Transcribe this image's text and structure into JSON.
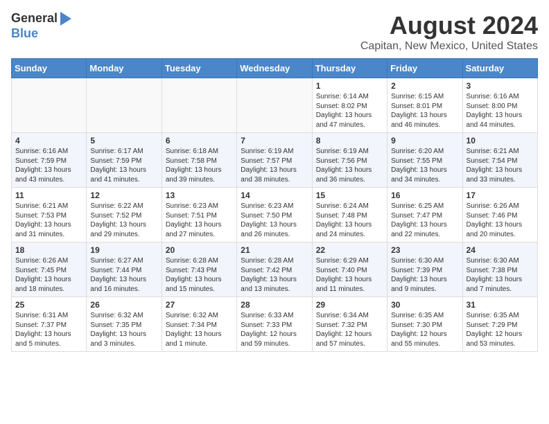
{
  "logo": {
    "line1": "General",
    "line2": "Blue"
  },
  "title": "August 2024",
  "subtitle": "Capitan, New Mexico, United States",
  "days_of_week": [
    "Sunday",
    "Monday",
    "Tuesday",
    "Wednesday",
    "Thursday",
    "Friday",
    "Saturday"
  ],
  "weeks": [
    [
      {
        "day": "",
        "info": ""
      },
      {
        "day": "",
        "info": ""
      },
      {
        "day": "",
        "info": ""
      },
      {
        "day": "",
        "info": ""
      },
      {
        "day": "1",
        "info": "Sunrise: 6:14 AM\nSunset: 8:02 PM\nDaylight: 13 hours\nand 47 minutes."
      },
      {
        "day": "2",
        "info": "Sunrise: 6:15 AM\nSunset: 8:01 PM\nDaylight: 13 hours\nand 46 minutes."
      },
      {
        "day": "3",
        "info": "Sunrise: 6:16 AM\nSunset: 8:00 PM\nDaylight: 13 hours\nand 44 minutes."
      }
    ],
    [
      {
        "day": "4",
        "info": "Sunrise: 6:16 AM\nSunset: 7:59 PM\nDaylight: 13 hours\nand 43 minutes."
      },
      {
        "day": "5",
        "info": "Sunrise: 6:17 AM\nSunset: 7:59 PM\nDaylight: 13 hours\nand 41 minutes."
      },
      {
        "day": "6",
        "info": "Sunrise: 6:18 AM\nSunset: 7:58 PM\nDaylight: 13 hours\nand 39 minutes."
      },
      {
        "day": "7",
        "info": "Sunrise: 6:19 AM\nSunset: 7:57 PM\nDaylight: 13 hours\nand 38 minutes."
      },
      {
        "day": "8",
        "info": "Sunrise: 6:19 AM\nSunset: 7:56 PM\nDaylight: 13 hours\nand 36 minutes."
      },
      {
        "day": "9",
        "info": "Sunrise: 6:20 AM\nSunset: 7:55 PM\nDaylight: 13 hours\nand 34 minutes."
      },
      {
        "day": "10",
        "info": "Sunrise: 6:21 AM\nSunset: 7:54 PM\nDaylight: 13 hours\nand 33 minutes."
      }
    ],
    [
      {
        "day": "11",
        "info": "Sunrise: 6:21 AM\nSunset: 7:53 PM\nDaylight: 13 hours\nand 31 minutes."
      },
      {
        "day": "12",
        "info": "Sunrise: 6:22 AM\nSunset: 7:52 PM\nDaylight: 13 hours\nand 29 minutes."
      },
      {
        "day": "13",
        "info": "Sunrise: 6:23 AM\nSunset: 7:51 PM\nDaylight: 13 hours\nand 27 minutes."
      },
      {
        "day": "14",
        "info": "Sunrise: 6:23 AM\nSunset: 7:50 PM\nDaylight: 13 hours\nand 26 minutes."
      },
      {
        "day": "15",
        "info": "Sunrise: 6:24 AM\nSunset: 7:48 PM\nDaylight: 13 hours\nand 24 minutes."
      },
      {
        "day": "16",
        "info": "Sunrise: 6:25 AM\nSunset: 7:47 PM\nDaylight: 13 hours\nand 22 minutes."
      },
      {
        "day": "17",
        "info": "Sunrise: 6:26 AM\nSunset: 7:46 PM\nDaylight: 13 hours\nand 20 minutes."
      }
    ],
    [
      {
        "day": "18",
        "info": "Sunrise: 6:26 AM\nSunset: 7:45 PM\nDaylight: 13 hours\nand 18 minutes."
      },
      {
        "day": "19",
        "info": "Sunrise: 6:27 AM\nSunset: 7:44 PM\nDaylight: 13 hours\nand 16 minutes."
      },
      {
        "day": "20",
        "info": "Sunrise: 6:28 AM\nSunset: 7:43 PM\nDaylight: 13 hours\nand 15 minutes."
      },
      {
        "day": "21",
        "info": "Sunrise: 6:28 AM\nSunset: 7:42 PM\nDaylight: 13 hours\nand 13 minutes."
      },
      {
        "day": "22",
        "info": "Sunrise: 6:29 AM\nSunset: 7:40 PM\nDaylight: 13 hours\nand 11 minutes."
      },
      {
        "day": "23",
        "info": "Sunrise: 6:30 AM\nSunset: 7:39 PM\nDaylight: 13 hours\nand 9 minutes."
      },
      {
        "day": "24",
        "info": "Sunrise: 6:30 AM\nSunset: 7:38 PM\nDaylight: 13 hours\nand 7 minutes."
      }
    ],
    [
      {
        "day": "25",
        "info": "Sunrise: 6:31 AM\nSunset: 7:37 PM\nDaylight: 13 hours\nand 5 minutes."
      },
      {
        "day": "26",
        "info": "Sunrise: 6:32 AM\nSunset: 7:35 PM\nDaylight: 13 hours\nand 3 minutes."
      },
      {
        "day": "27",
        "info": "Sunrise: 6:32 AM\nSunset: 7:34 PM\nDaylight: 13 hours\nand 1 minute."
      },
      {
        "day": "28",
        "info": "Sunrise: 6:33 AM\nSunset: 7:33 PM\nDaylight: 12 hours\nand 59 minutes."
      },
      {
        "day": "29",
        "info": "Sunrise: 6:34 AM\nSunset: 7:32 PM\nDaylight: 12 hours\nand 57 minutes."
      },
      {
        "day": "30",
        "info": "Sunrise: 6:35 AM\nSunset: 7:30 PM\nDaylight: 12 hours\nand 55 minutes."
      },
      {
        "day": "31",
        "info": "Sunrise: 6:35 AM\nSunset: 7:29 PM\nDaylight: 12 hours\nand 53 minutes."
      }
    ]
  ]
}
